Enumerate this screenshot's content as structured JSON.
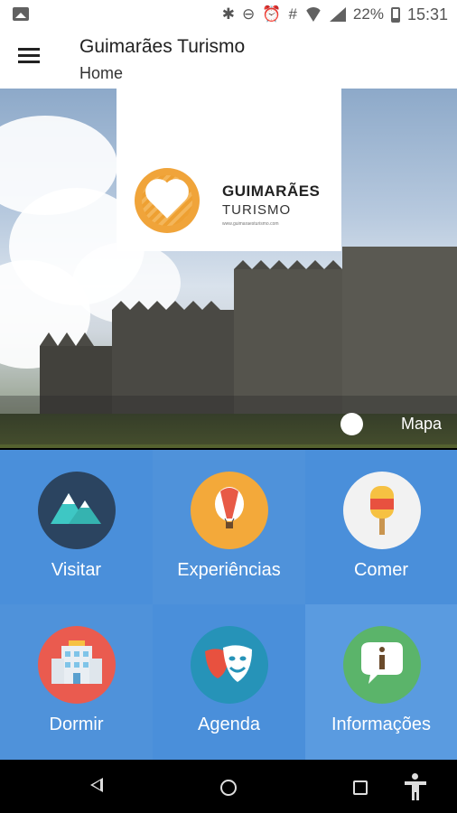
{
  "status_bar": {
    "battery_percent": "22%",
    "time": "15:31",
    "hash_glyph": "#",
    "icons": [
      "image-icon",
      "bluetooth-icon",
      "do-not-disturb-icon",
      "alarm-icon",
      "hash-icon",
      "wifi-icon",
      "signal-icon",
      "battery-icon"
    ]
  },
  "app_bar": {
    "title": "Guimarães Turismo",
    "subtitle": "Home",
    "menu_icon": "hamburger-menu-icon"
  },
  "hero": {
    "logo": {
      "line1": "GUIMARÃES",
      "line2": "TURISMO",
      "line3": "www.guimaraesturismo.com",
      "brand_color": "#f0a43a"
    },
    "map_label": "Mapa",
    "carousel_dot": "carousel-dot"
  },
  "grid": {
    "tiles": [
      {
        "label": "Visitar",
        "icon": "mountains-icon",
        "bg": "#4a8fda",
        "circle": "#2b4460"
      },
      {
        "label": "Experiências",
        "icon": "hot-air-balloon-icon",
        "bg": "#4f92da",
        "circle": "#f3a93a"
      },
      {
        "label": "Comer",
        "icon": "popsicle-icon",
        "bg": "#4a8fda",
        "circle": "#f2f2f2"
      },
      {
        "label": "Dormir",
        "icon": "hotel-building-icon",
        "bg": "#4f92da",
        "circle": "#ea5b4f"
      },
      {
        "label": "Agenda",
        "icon": "theater-masks-icon",
        "bg": "#4a8fda",
        "circle": "#2693b8"
      },
      {
        "label": "Informações",
        "icon": "info-bubble-icon",
        "bg": "#5a9be0",
        "circle": "#5bb46a"
      }
    ]
  },
  "nav_bar": {
    "icons": [
      "back-icon",
      "home-icon",
      "recents-icon",
      "accessibility-icon"
    ]
  }
}
